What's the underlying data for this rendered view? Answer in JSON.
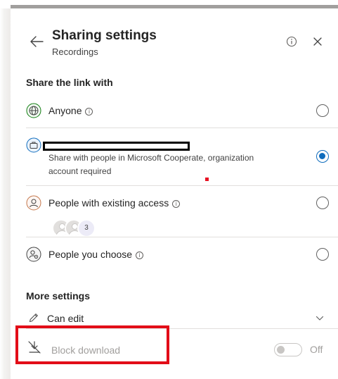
{
  "header": {
    "title": "Sharing settings",
    "subtitle": "Recordings",
    "back_icon": "arrow-left-icon",
    "info_icon": "info-icon",
    "close_icon": "close-icon"
  },
  "share_section": {
    "title": "Share the link with",
    "options": [
      {
        "label": "Anyone",
        "icon": "globe-icon",
        "selected": false,
        "has_info": true
      },
      {
        "label": "",
        "redacted": true,
        "description": "Share with people in Microsoft Cooperate, organization account required",
        "icon": "briefcase-icon",
        "selected": true
      },
      {
        "label": "People with existing access",
        "icon": "person-icon",
        "selected": false,
        "has_info": true,
        "avatar_count": "3"
      },
      {
        "label": "People you choose",
        "icon": "people-gear-icon",
        "selected": false,
        "has_info": true
      }
    ]
  },
  "more_settings": {
    "title": "More settings",
    "can_edit": {
      "label": "Can edit",
      "icon": "pencil-icon",
      "expand_icon": "chevron-down-icon"
    },
    "block_download": {
      "label": "Block download",
      "icon": "download-blocked-icon",
      "toggle_state": "Off",
      "enabled": false
    }
  },
  "colors": {
    "accent": "#0f6cbd",
    "highlight_box": "#e20d18",
    "divider": "#e1dfdd"
  }
}
